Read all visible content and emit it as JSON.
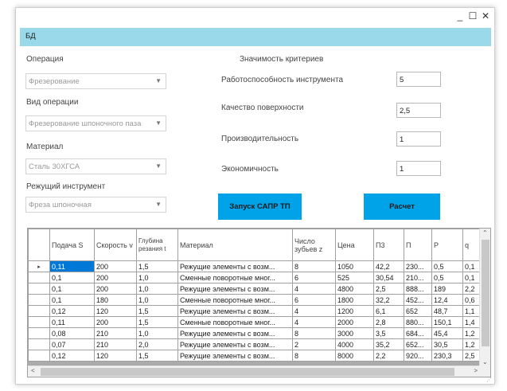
{
  "window": {
    "minimize_icon": "minimize-icon",
    "maximize_icon": "maximize-icon",
    "close_icon": "close-icon",
    "minimize_glyph": "_",
    "maximize_glyph": "☐",
    "close_glyph": "✕"
  },
  "menu": {
    "item": "БД"
  },
  "left_form": {
    "operation_label": "Операция",
    "operation_value": "Фрезерование",
    "operation_type_label": "Вид операции",
    "operation_type_value": "Фрезерование шпоночного паза",
    "material_label": "Материал",
    "material_value": "Сталь 30ХГСА",
    "tool_label": "Режущий инструмент",
    "tool_value": "Фреза шпоночная",
    "dropdown_glyph": "▼"
  },
  "criteria": {
    "heading": "Значимость критериев",
    "items": [
      {
        "label": "Работоспособность инструмента",
        "value": "5"
      },
      {
        "label": "Качество поверхности",
        "value": "2,5"
      },
      {
        "label": "Производительность",
        "value": "1"
      },
      {
        "label": "Экономичность",
        "value": "1"
      }
    ]
  },
  "buttons": {
    "launch": "Запуск САПР ТП",
    "calc": "Расчет"
  },
  "grid": {
    "columns": [
      "Подача S",
      "Скорость v",
      "Глубина резания t",
      "Материал",
      "Число зубьев z",
      "Цена",
      "П3",
      "П",
      "P",
      "q"
    ],
    "row_marker": "▸",
    "rows": [
      [
        "0,11",
        "200",
        "1,5",
        "Режущие элементы с возм...",
        "8",
        "1050",
        "42,2",
        "230...",
        "0,5",
        "0,1"
      ],
      [
        "0,1",
        "200",
        "1,0",
        "Сменные поворотные мног...",
        "6",
        "525",
        "30,54",
        "210...",
        "0,5",
        "0,1"
      ],
      [
        "0,1",
        "200",
        "1,0",
        "Режущие элементы с возм...",
        "4",
        "4800",
        "2,5",
        "888...",
        "189",
        "2,2"
      ],
      [
        "0,1",
        "180",
        "1,0",
        "Сменные поворотные мног...",
        "6",
        "1800",
        "32,2",
        "452...",
        "12,4",
        "0,6"
      ],
      [
        "0,12",
        "120",
        "1,5",
        "Режущие элементы с возм...",
        "4",
        "1200",
        "6,1",
        "652",
        "48,7",
        "1,1"
      ],
      [
        "0,11",
        "200",
        "1,5",
        "Сменные поворотные мног...",
        "4",
        "2000",
        "2,8",
        "880...",
        "150,1",
        "1,4"
      ],
      [
        "0,08",
        "210",
        "1,0",
        "Режущие элементы с возм...",
        "8",
        "3000",
        "3,5",
        "684...",
        "45,4",
        "1,2"
      ],
      [
        "0,07",
        "210",
        "2,0",
        "Режущие элементы с возм...",
        "2",
        "4000",
        "35,2",
        "652...",
        "30,5",
        "1,2"
      ],
      [
        "0,12",
        "120",
        "1,5",
        "Режущие элементы с возм...",
        "8",
        "8000",
        "2,2",
        "920...",
        "230,3",
        "2,5"
      ]
    ],
    "scroll_up": "⌃",
    "scroll_down": "⌄",
    "scroll_left": "<",
    "scroll_right": ">",
    "resize_grip": "⋰"
  }
}
